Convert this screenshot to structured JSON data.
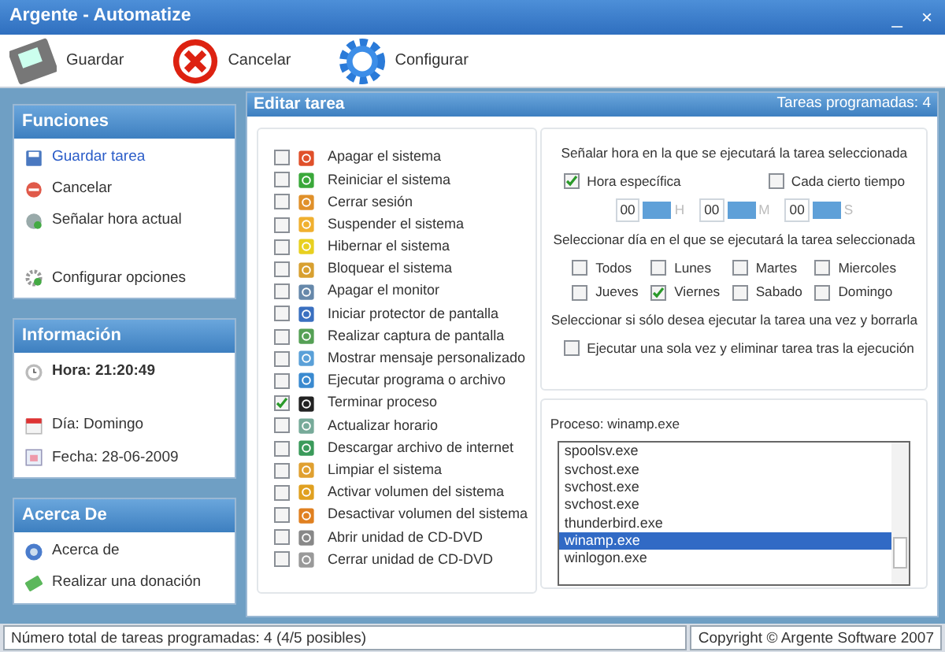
{
  "window": {
    "title": "Argente - Automatize",
    "controls": [
      "_",
      "×"
    ]
  },
  "toolbar": [
    {
      "label": "Guardar"
    },
    {
      "label": "Cancelar"
    },
    {
      "label": "Configurar"
    }
  ],
  "sidebar": [
    {
      "title": "Funciones",
      "items": [
        {
          "label": "Guardar tarea",
          "link": true,
          "bold": false
        },
        {
          "label": "Cancelar",
          "link": false,
          "bold": false
        },
        {
          "label": "Señalar hora actual",
          "link": false,
          "bold": false
        },
        {
          "label": "Configurar opciones",
          "link": false,
          "bold": false
        }
      ]
    },
    {
      "title": "Información",
      "items": [
        {
          "label": "Hora: 21:20:49",
          "link": false,
          "bold": true
        },
        {
          "label": "Día: Domingo",
          "link": false,
          "bold": false
        },
        {
          "label": "Fecha: 28-06-2009",
          "link": false,
          "bold": false
        }
      ]
    },
    {
      "title": "Acerca De",
      "items": [
        {
          "label": "Acerca de",
          "link": false,
          "bold": false
        },
        {
          "label": "Realizar una donación",
          "link": false,
          "bold": false
        }
      ]
    }
  ],
  "editor": {
    "title": "Editar tarea",
    "count": "Tareas programadas: 4",
    "tasks": [
      {
        "label": "Apagar el sistema",
        "checked": false
      },
      {
        "label": "Reiniciar el sistema",
        "checked": false
      },
      {
        "label": "Cerrar sesión",
        "checked": false
      },
      {
        "label": "Suspender el sistema",
        "checked": false
      },
      {
        "label": "Hibernar el sistema",
        "checked": false
      },
      {
        "label": "Bloquear el sistema",
        "checked": false
      },
      {
        "label": "Apagar el monitor",
        "checked": false
      },
      {
        "label": "Iniciar protector de pantalla",
        "checked": false
      },
      {
        "label": "Realizar captura de pantalla",
        "checked": false
      },
      {
        "label": "Mostrar mensaje personalizado",
        "checked": false
      },
      {
        "label": "Ejecutar programa o archivo",
        "checked": false
      },
      {
        "label": "Terminar proceso",
        "checked": true
      },
      {
        "label": "Actualizar horario",
        "checked": false
      },
      {
        "label": "Descargar archivo de internet",
        "checked": false
      },
      {
        "label": "Limpiar el sistema",
        "checked": false
      },
      {
        "label": "Activar volumen del sistema",
        "checked": false
      },
      {
        "label": "Desactivar volumen del sistema",
        "checked": false
      },
      {
        "label": "Abrir unidad de CD-DVD",
        "checked": false
      },
      {
        "label": "Cerrar unidad de CD-DVD",
        "checked": false
      }
    ],
    "time": {
      "heading": "Señalar hora en la que se ejecutará la tarea seleccionada",
      "modes": [
        {
          "label": "Hora específica",
          "checked": true
        },
        {
          "label": "Cada cierto tiempo",
          "checked": false
        }
      ],
      "spinners": [
        {
          "value": "00",
          "unit": "H"
        },
        {
          "value": "00",
          "unit": "M"
        },
        {
          "value": "00",
          "unit": "S"
        }
      ],
      "days_heading": "Seleccionar día en el que se ejecutará la tarea seleccionada",
      "days": [
        {
          "label": "Todos",
          "checked": false
        },
        {
          "label": "Lunes",
          "checked": false
        },
        {
          "label": "Martes",
          "checked": false
        },
        {
          "label": "Miercoles",
          "checked": false
        },
        {
          "label": "Jueves",
          "checked": false
        },
        {
          "label": "Viernes",
          "checked": true
        },
        {
          "label": "Sabado",
          "checked": false
        },
        {
          "label": "Domingo",
          "checked": false
        }
      ],
      "once_heading": "Seleccionar si sólo desea ejecutar la tarea una vez y borrarla",
      "once": {
        "label": "Ejecutar una sola vez y eliminar tarea tras la ejecución",
        "checked": false
      }
    },
    "process": {
      "label": "Proceso: winamp.exe",
      "items": [
        {
          "label": "spoolsv.exe",
          "selected": false
        },
        {
          "label": "svchost.exe",
          "selected": false
        },
        {
          "label": "svchost.exe",
          "selected": false
        },
        {
          "label": "svchost.exe",
          "selected": false
        },
        {
          "label": "thunderbird.exe",
          "selected": false
        },
        {
          "label": "winamp.exe",
          "selected": true
        },
        {
          "label": "winlogon.exe",
          "selected": false
        }
      ]
    }
  },
  "status_bar": {
    "left": "Número total de tareas programadas: 4 (4/5 posibles)",
    "right": "Copyright © Argente Software 2007"
  }
}
